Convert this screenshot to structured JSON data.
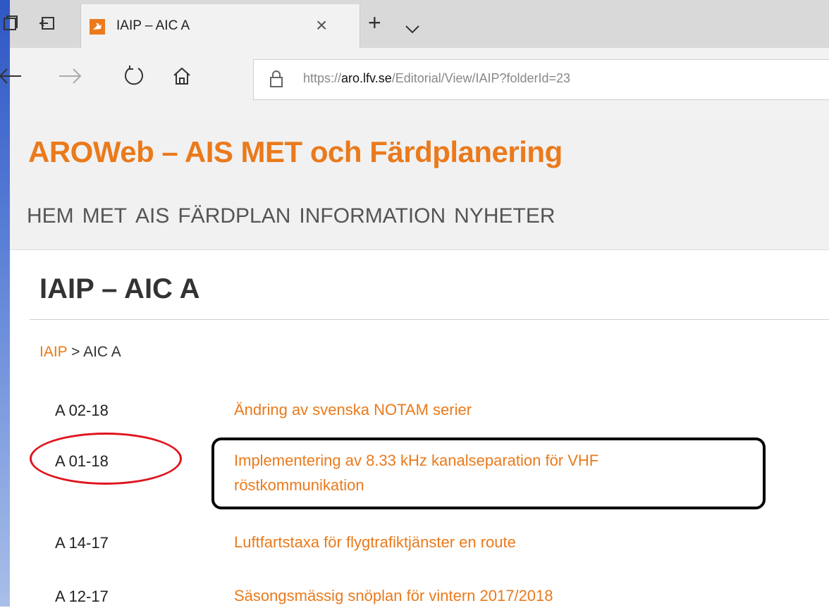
{
  "browser": {
    "tab_title": "IAIP – AIC A",
    "address": {
      "url_prefix": "https://",
      "url_domain": "aro.lfv.se",
      "url_path": "/Editorial/View/IAIP?folderId=23"
    }
  },
  "site": {
    "title": "AROWeb – AIS MET och Färdplanering",
    "nav": [
      "HEM",
      "MET",
      "AIS",
      "FÄRDPLAN",
      "INFORMATION",
      "NYHETER"
    ]
  },
  "page": {
    "title": "IAIP – AIC A",
    "breadcrumb": {
      "link": "IAIP",
      "separator": " > ",
      "current": "AIC A"
    },
    "items": [
      {
        "code": "A 02-18",
        "title": "Ändring av svenska NOTAM serier"
      },
      {
        "code": "A 01-18",
        "title": "Implementering av 8.33 kHz kanalseparation för VHF röstkommunikation"
      },
      {
        "code": "A 14-17",
        "title": "Luftfartstaxa för flygtrafiktjänster en route"
      },
      {
        "code": "A 12-17",
        "title": "Säsongsmässig snöplan för vintern 2017/2018"
      }
    ]
  },
  "colors": {
    "accent": "#ea7a1c",
    "annotation_box": "#000000",
    "annotation_ellipse": "#e0141e"
  },
  "icons": [
    "collections-icon",
    "tab-aside-icon",
    "favicon-icon",
    "close-icon",
    "new-tab-icon",
    "tab-list-icon",
    "back-icon",
    "forward-icon",
    "refresh-icon",
    "home-icon",
    "lock-icon"
  ]
}
